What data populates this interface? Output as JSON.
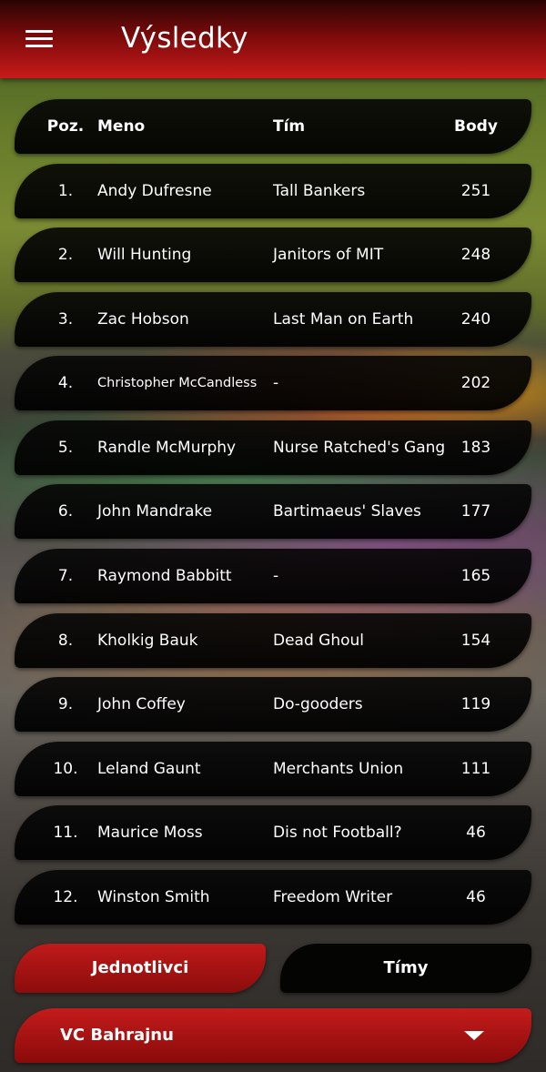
{
  "header": {
    "title": "Výsledky",
    "menu_icon": "hamburger-menu-icon"
  },
  "table": {
    "columns": {
      "pos": "Poz.",
      "name": "Meno",
      "team": "Tím",
      "points": "Body"
    },
    "rows": [
      {
        "pos": "1.",
        "name": "Andy Dufresne",
        "team": "Tall Bankers",
        "points": "251"
      },
      {
        "pos": "2.",
        "name": "Will Hunting",
        "team": "Janitors of MIT",
        "points": "248"
      },
      {
        "pos": "3.",
        "name": "Zac Hobson",
        "team": "Last Man on Earth",
        "points": "240"
      },
      {
        "pos": "4.",
        "name": "Christopher McCandless",
        "team": "-",
        "points": "202"
      },
      {
        "pos": "5.",
        "name": "Randle McMurphy",
        "team": "Nurse Ratched's Gang",
        "points": "183"
      },
      {
        "pos": "6.",
        "name": "John Mandrake",
        "team": "Bartimaeus' Slaves",
        "points": "177"
      },
      {
        "pos": "7.",
        "name": "Raymond Babbitt",
        "team": "-",
        "points": "165"
      },
      {
        "pos": "8.",
        "name": "Kholkig Bauk",
        "team": "Dead Ghoul",
        "points": "154"
      },
      {
        "pos": "9.",
        "name": "John Coffey",
        "team": "Do-gooders",
        "points": "119"
      },
      {
        "pos": "10.",
        "name": "Leland Gaunt",
        "team": "Merchants Union",
        "points": "111"
      },
      {
        "pos": "11.",
        "name": "Maurice Moss",
        "team": "Dis not Football?",
        "points": "46"
      },
      {
        "pos": "12.",
        "name": "Winston Smith",
        "team": "Freedom Writer",
        "points": "46"
      }
    ]
  },
  "tabs": {
    "individual": "Jednotlivci",
    "teams": "Tímy",
    "active": "individual"
  },
  "race_selector": {
    "value": "VC Bahrajnu",
    "icon": "dropdown-caret-icon"
  },
  "colors": {
    "accent_red": "#c41c1c",
    "row_background": "#000000",
    "text": "#ffffff"
  }
}
